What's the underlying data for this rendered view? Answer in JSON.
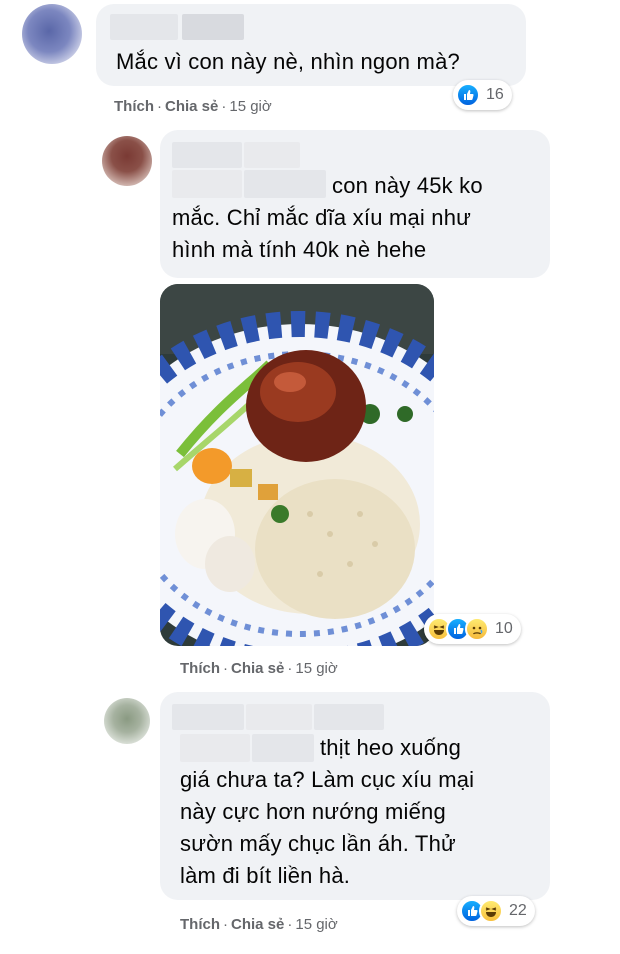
{
  "comments": [
    {
      "text": "Mắc vì con này nè, nhìn ngon mà?",
      "actions": {
        "like": "Thích",
        "share": "Chia sẻ",
        "time": "15 giờ",
        "sep": "·"
      },
      "reactions": {
        "count": "16",
        "icons": [
          "like-icon"
        ]
      }
    },
    {
      "text_line1": "con này 45k ko",
      "text_line2": "mắc. Chỉ mắc dĩa xíu mại như",
      "text_line3": "hình mà tính 40k nè hehe",
      "image_label": "food-photo",
      "actions": {
        "like": "Thích",
        "share": "Chia sẻ",
        "time": "15 giờ",
        "sep": "·"
      },
      "reactions": {
        "count": "10",
        "icons": [
          "haha-icon",
          "like-icon",
          "sad-icon"
        ]
      }
    },
    {
      "text_line1": "thịt heo xuống",
      "text_line2": "giá chưa ta? Làm cục xíu mại",
      "text_line3": "này cực hơn nướng miếng",
      "text_line4": "sườn mấy chục lần áh. Thử",
      "text_line5": "làm đi bít liền hà.",
      "actions": {
        "like": "Thích",
        "share": "Chia sẻ",
        "time": "15 giờ",
        "sep": "·"
      },
      "reactions": {
        "count": "22",
        "icons": [
          "like-icon",
          "haha-icon"
        ]
      }
    }
  ],
  "colors": {
    "bubble": "#f0f2f5",
    "meta_text": "#65676b",
    "like_blue": "#1877f2",
    "haha_yellow": "#f8c03d"
  }
}
